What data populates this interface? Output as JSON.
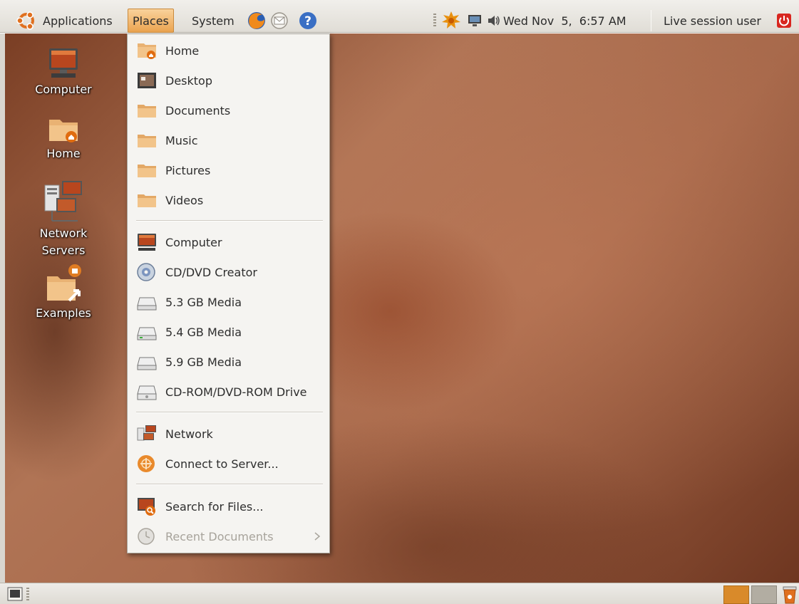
{
  "top_panel": {
    "applications_label": "Applications",
    "places_label": "Places",
    "system_label": "System",
    "clock": "Wed Nov  5,  6:57 AM",
    "user": "Live session user"
  },
  "desktop_icons": [
    {
      "label": "Computer",
      "icon": "computer-icon"
    },
    {
      "label": "Home",
      "icon": "home-folder-icon"
    },
    {
      "label": "Network\nServers",
      "icon": "network-servers-icon"
    },
    {
      "label": "Examples",
      "icon": "examples-folder-icon"
    }
  ],
  "places_menu": {
    "items": [
      {
        "label": "Home",
        "icon": "home-folder-icon"
      },
      {
        "label": "Desktop",
        "icon": "desktop-icon"
      },
      {
        "label": "Documents",
        "icon": "folder-icon"
      },
      {
        "label": "Music",
        "icon": "folder-icon"
      },
      {
        "label": "Pictures",
        "icon": "folder-icon"
      },
      {
        "label": "Videos",
        "icon": "folder-icon"
      },
      {
        "label": "Computer",
        "icon": "computer-icon"
      },
      {
        "label": "CD/DVD Creator",
        "icon": "cd-icon"
      },
      {
        "label": "5.3 GB Media",
        "icon": "drive-icon"
      },
      {
        "label": "5.4 GB Media",
        "icon": "drive-icon"
      },
      {
        "label": "5.9 GB Media",
        "icon": "drive-icon"
      },
      {
        "label": "CD-ROM/DVD-ROM Drive",
        "icon": "optical-drive-icon"
      },
      {
        "label": "Network",
        "icon": "network-icon"
      },
      {
        "label": "Connect to Server...",
        "icon": "connect-server-icon"
      },
      {
        "label": "Search for Files...",
        "icon": "search-icon"
      },
      {
        "label": "Recent Documents",
        "icon": "recent-documents-icon"
      }
    ]
  },
  "colors": {
    "menu_highlight": "#eba450",
    "panel_bg": "#e6e3dd",
    "menu_bg": "#f5f4f1",
    "disabled_text": "#a7a39b"
  }
}
